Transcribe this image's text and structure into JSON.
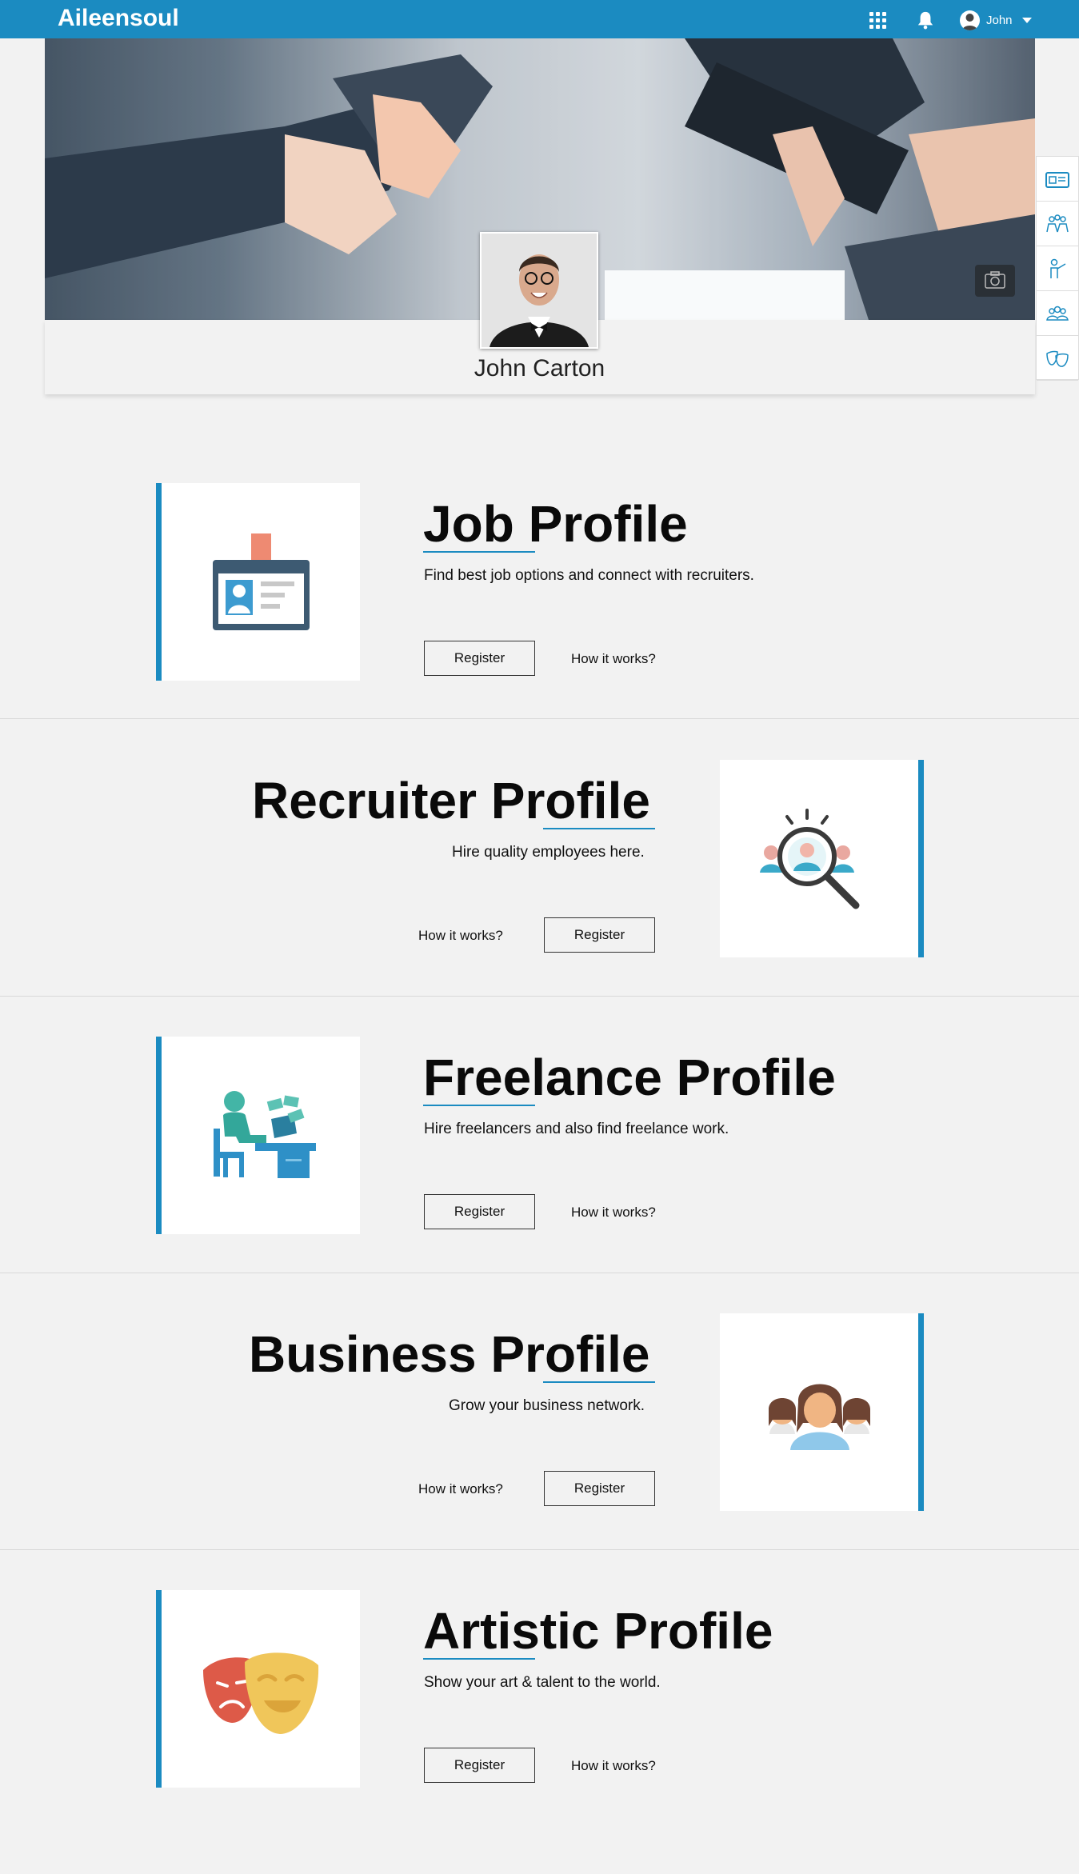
{
  "header": {
    "brand": "Aileensoul",
    "user_name": "John"
  },
  "profile": {
    "name": "John Carton"
  },
  "sections": [
    {
      "title": "Job Profile",
      "description": "Find best job options and connect with recruiters.",
      "register_label": "Register",
      "how_label": "How it works?"
    },
    {
      "title": "Recruiter Profile",
      "description": "Hire quality employees here.",
      "register_label": "Register",
      "how_label": "How it works?"
    },
    {
      "title": "Freelance Profile",
      "description": "Hire freelancers and also find freelance work.",
      "register_label": "Register",
      "how_label": "How it works?"
    },
    {
      "title": "Business Profile",
      "description": "Grow your business network.",
      "register_label": "Register",
      "how_label": "How it works?"
    },
    {
      "title": "Artistic Profile",
      "description": "Show your art & talent to the world.",
      "register_label": "Register",
      "how_label": "How it works?"
    }
  ],
  "colors": {
    "accent": "#1b8bc1",
    "background": "#f2f2f2"
  },
  "icons": [
    "grid-icon",
    "bell-icon",
    "camera-icon",
    "job-badge-icon",
    "recruiter-search-icon",
    "freelancer-desk-icon",
    "business-team-icon",
    "theatre-masks-icon"
  ]
}
